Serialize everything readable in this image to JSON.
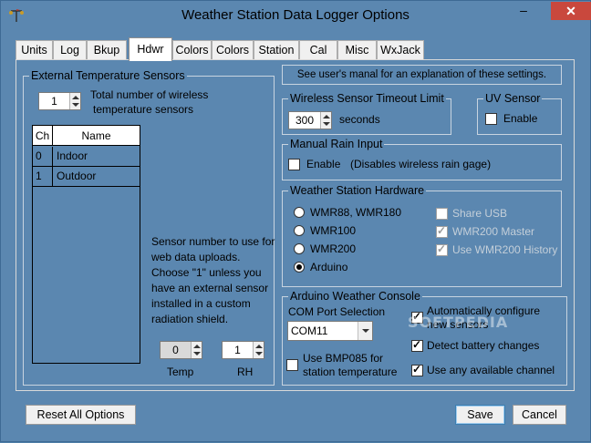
{
  "window": {
    "title": "Weather Station Data Logger Options"
  },
  "titlebar": {
    "minimize": "‒",
    "maximize": "□",
    "close": "✕"
  },
  "tabs": [
    "Units",
    "Log",
    "Bkup",
    "Hdwr",
    "Colors",
    "Colors",
    "Station",
    "Cal",
    "Misc",
    "WxJack"
  ],
  "active_tab": "Hdwr",
  "external_sensors": {
    "title": "External Temperature Sensors",
    "count_value": "1",
    "count_label_1": "Total number of wireless",
    "count_label_2": "temperature sensors",
    "grid_headers": {
      "ch": "Ch",
      "name": "Name"
    },
    "rows": [
      {
        "ch": "0",
        "name": "Indoor"
      },
      {
        "ch": "1",
        "name": "Outdoor"
      }
    ],
    "upload_note": [
      "Sensor number to use for",
      "web data uploads.",
      "Choose \"1\" unless you",
      "have an external sensor",
      "installed in a custom",
      "radiation shield."
    ],
    "temp_value": "0",
    "temp_label": "Temp",
    "rh_value": "1",
    "rh_label": "RH"
  },
  "manual_note": "See user's manal for an explanation of these settings.",
  "timeout": {
    "title": "Wireless Sensor Timeout Limit",
    "value": "300",
    "unit": "seconds"
  },
  "uv": {
    "title": "UV Sensor",
    "enable_label": "Enable",
    "checked": false
  },
  "rain": {
    "title": "Manual Rain Input",
    "enable_label": "Enable",
    "note": "(Disables wireless rain gage)",
    "checked": false
  },
  "hardware": {
    "title": "Weather Station Hardware",
    "options": [
      "WMR88, WMR180",
      "WMR100",
      "WMR200",
      "Arduino"
    ],
    "selected": "Arduino",
    "share_usb": "Share USB",
    "wmr200_master": "WMR200 Master",
    "wmr200_history": "Use WMR200 History"
  },
  "arduino": {
    "title": "Arduino Weather Console",
    "com_label": "COM Port Selection",
    "com_value": "COM11",
    "bmp_label_1": "Use BMP085 for",
    "bmp_label_2": "station temperature",
    "auto_config_1": "Automatically configure",
    "auto_config_2": "new sensors",
    "detect_battery": "Detect battery changes",
    "any_channel": "Use any available channel"
  },
  "watermark": "SOFTPEDIA",
  "buttons": {
    "reset": "Reset All Options",
    "save": "Save",
    "cancel": "Cancel"
  }
}
